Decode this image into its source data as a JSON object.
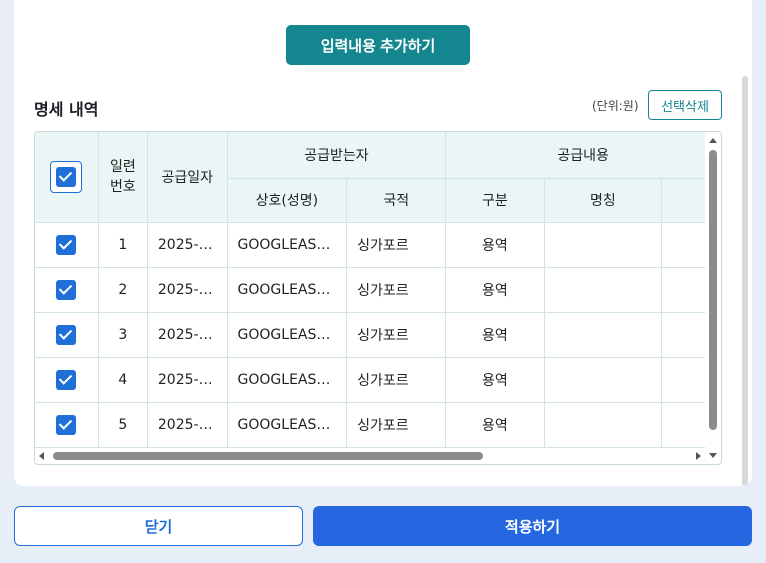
{
  "add_button_label": "입력내용 추가하기",
  "section": {
    "title": "명세 내역",
    "unit": "(단위:원)",
    "delete_selected_label": "선택삭제"
  },
  "table": {
    "headers": {
      "serial": "일련\n번호",
      "supply_date": "공급일자",
      "receiver_group": "공급받는자",
      "supply_group": "공급내용",
      "company_name": "상호(성명)",
      "country": "국적",
      "category": "구분",
      "item_name": "명칭"
    },
    "rows": [
      {
        "no": "1",
        "date": "2025-…",
        "company": "GOOGLEAS…",
        "country": "싱가포르",
        "category": "용역",
        "item": ""
      },
      {
        "no": "2",
        "date": "2025-…",
        "company": "GOOGLEAS…",
        "country": "싱가포르",
        "category": "용역",
        "item": ""
      },
      {
        "no": "3",
        "date": "2025-…",
        "company": "GOOGLEAS…",
        "country": "싱가포르",
        "category": "용역",
        "item": ""
      },
      {
        "no": "4",
        "date": "2025-…",
        "company": "GOOGLEAS…",
        "country": "싱가포르",
        "category": "용역",
        "item": ""
      },
      {
        "no": "5",
        "date": "2025-…",
        "company": "GOOGLEAS…",
        "country": "싱가포르",
        "category": "용역",
        "item": ""
      }
    ]
  },
  "footer": {
    "close_label": "닫기",
    "apply_label": "적용하기"
  },
  "colors": {
    "teal": "#14868f",
    "blue": "#2567e0",
    "header_bg": "#e9f6f5"
  }
}
